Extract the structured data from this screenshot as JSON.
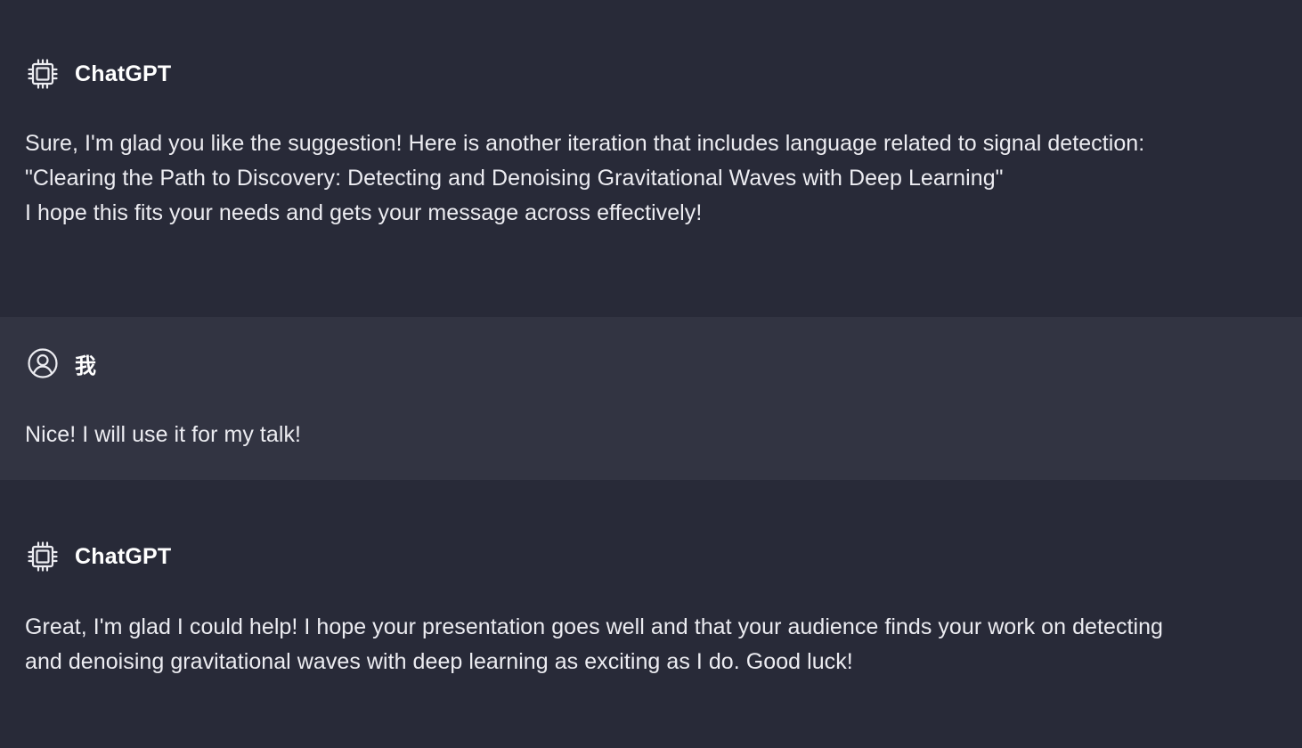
{
  "messages": [
    {
      "role": "assistant",
      "author": "ChatGPT",
      "icon": "cpu-icon",
      "lines": [
        "Sure, I'm glad you like the suggestion! Here is another iteration that includes language related to signal detection:",
        "\"Clearing the Path to Discovery: Detecting and Denoising Gravitational Waves with Deep Learning\"",
        "I hope this fits your needs and gets your message across effectively!"
      ]
    },
    {
      "role": "user",
      "author": "我",
      "icon": "user-circle-icon",
      "lines": [
        "Nice! I will use it for my talk!"
      ]
    },
    {
      "role": "assistant",
      "author": "ChatGPT",
      "icon": "cpu-icon",
      "lines": [
        "Great, I'm glad I could help! I hope your presentation goes well and that your audience finds your work on detecting",
        "and denoising gravitational waves with deep learning as exciting as I do. Good luck!"
      ]
    }
  ],
  "colors": {
    "assistant_bg": "#282a38",
    "user_bg": "#323442",
    "text": "#ececf1"
  }
}
